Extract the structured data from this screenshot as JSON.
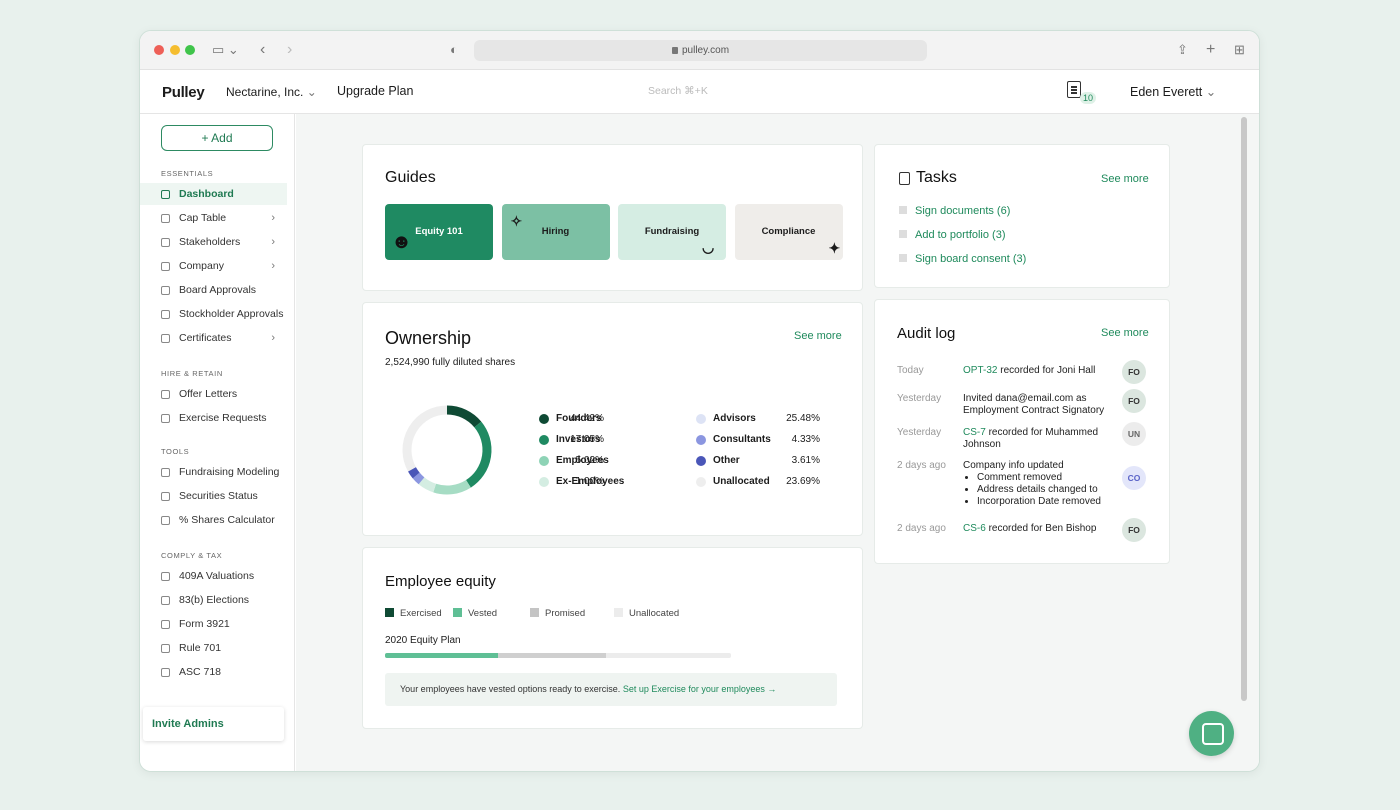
{
  "browser": {
    "url": "pulley.com"
  },
  "topbar": {
    "logo": "Pulley",
    "company": "Nectarine, Inc.",
    "upgrade": "Upgrade Plan",
    "search_placeholder": "Search ⌘+K",
    "task_count": "10",
    "user": "Eden Everett"
  },
  "sidebar": {
    "add_label": "+ Add",
    "sections": [
      {
        "title": "ESSENTIALS",
        "items": [
          {
            "label": "Dashboard",
            "active": true,
            "chevron": false,
            "icon": "home-icon"
          },
          {
            "label": "Cap Table",
            "chevron": true,
            "icon": "table-icon"
          },
          {
            "label": "Stakeholders",
            "chevron": true,
            "icon": "people-icon"
          },
          {
            "label": "Company",
            "chevron": true,
            "icon": "building-icon"
          },
          {
            "label": "Board Approvals",
            "chevron": false,
            "icon": "thumbs-up-icon"
          },
          {
            "label": "Stockholder Approvals",
            "chevron": false,
            "icon": "thumbs-up-icon"
          },
          {
            "label": "Certificates",
            "chevron": true,
            "icon": "certificate-icon"
          }
        ]
      },
      {
        "title": "HIRE & RETAIN",
        "items": [
          {
            "label": "Offer Letters",
            "icon": "heart-icon"
          },
          {
            "label": "Exercise Requests",
            "icon": "coin-icon"
          }
        ]
      },
      {
        "title": "TOOLS",
        "items": [
          {
            "label": "Fundraising Modeling",
            "icon": "sparkle-icon"
          },
          {
            "label": "Securities Status",
            "icon": "document-icon"
          },
          {
            "label": "% Shares Calculator",
            "icon": "calculator-icon"
          }
        ]
      },
      {
        "title": "COMPLY & TAX",
        "items": [
          {
            "label": "409A Valuations",
            "icon": "shield-check-icon"
          },
          {
            "label": "83(b) Elections",
            "icon": "shield-check-icon"
          },
          {
            "label": "Form 3921",
            "icon": "document-icon"
          },
          {
            "label": "Rule 701",
            "icon": "document-icon"
          },
          {
            "label": "ASC 718",
            "icon": "document-icon"
          }
        ]
      }
    ],
    "invite": "Invite Admins"
  },
  "guides": {
    "title": "Guides",
    "items": [
      {
        "label": "Equity 101",
        "bg": "#1f8a62",
        "color": "#ffffff"
      },
      {
        "label": "Hiring",
        "bg": "#7cc0a4",
        "color": "#1c1c1c"
      },
      {
        "label": "Fundraising",
        "bg": "#d5ede3",
        "color": "#1c1c1c"
      },
      {
        "label": "Compliance",
        "bg": "#efedea",
        "color": "#1c1c1c"
      }
    ]
  },
  "ownership": {
    "title": "Ownership",
    "see_more": "See more",
    "shares": "2,524,990",
    "shares_suffix": " fully diluted shares",
    "legend_left": [
      {
        "name": "Founders",
        "value": "44.42%",
        "color": "#0f4a34"
      },
      {
        "name": "Investors",
        "value": "17.05%",
        "color": "#1f8a62"
      },
      {
        "name": "Employees",
        "value": "5.02%",
        "color": "#8ed3b6"
      },
      {
        "name": "Ex-Employees",
        "value": "1.00%",
        "color": "#d4ede2"
      }
    ],
    "legend_right": [
      {
        "name": "Advisors",
        "value": "25.48%",
        "color": "#dde3f5"
      },
      {
        "name": "Consultants",
        "value": "4.33%",
        "color": "#8b96e0"
      },
      {
        "name": "Other",
        "value": "3.61%",
        "color": "#4a56b8"
      },
      {
        "name": "Unallocated",
        "value": "23.69%",
        "color": "#eeeeee"
      }
    ]
  },
  "chart_data": {
    "type": "pie",
    "segments": [
      {
        "name": "Founders",
        "value": 14,
        "color": "#0f4a34"
      },
      {
        "name": "Investors",
        "value": 27,
        "color": "#1f8a62"
      },
      {
        "name": "Employees",
        "value": 14,
        "color": "#a6dcc4"
      },
      {
        "name": "Ex-Employees",
        "value": 6,
        "color": "#d4ede2"
      },
      {
        "name": "Consultants",
        "value": 3,
        "color": "#8b96e0"
      },
      {
        "name": "Other",
        "value": 3,
        "color": "#4a56b8"
      },
      {
        "name": "Unallocated",
        "value": 33,
        "color": "#eeeeee"
      }
    ]
  },
  "employee_equity": {
    "title": "Employee equity",
    "legend": [
      {
        "label": "Exercised",
        "color": "#0f4a34"
      },
      {
        "label": "Vested",
        "color": "#5fbf95"
      },
      {
        "label": "Promised",
        "color": "#c4c4c4"
      },
      {
        "label": "Unallocated",
        "color": "#ececec"
      }
    ],
    "plan": "2020 Equity Plan",
    "bar": [
      {
        "name": "Vested",
        "fraction": 0.326,
        "color": "#5fbf95"
      },
      {
        "name": "Promised",
        "fraction": 0.312,
        "color": "#cfcfcf"
      },
      {
        "name": "Unallocated",
        "fraction": 0.362,
        "color": "#ececec"
      }
    ],
    "notice": "Your employees have vested options ready to exercise. ",
    "notice_link": "Set up Exercise for your employees →"
  },
  "tasks": {
    "title": "Tasks",
    "see_more": "See more",
    "items": [
      "Sign documents (6)",
      "Add to portfolio (3)",
      "Sign board consent (3)"
    ]
  },
  "audit": {
    "title": "Audit log",
    "see_more": "See more",
    "rows": [
      {
        "when": "Today",
        "link": "OPT-32",
        "text": " recorded for Joni Hall",
        "avatar": "FO",
        "av_bg": "#dbe6df",
        "av_color": "#333"
      },
      {
        "when": "Yesterday",
        "link": "",
        "text": "Invited dana@email.com as Employment Contract Signatory",
        "avatar": "FO",
        "av_bg": "#dbe6df",
        "av_color": "#333"
      },
      {
        "when": "Yesterday",
        "link": "CS-7",
        "text": " recorded for Muhammed Johnson",
        "avatar": "UN",
        "av_bg": "#ececec",
        "av_color": "#666"
      },
      {
        "when": "2 days ago",
        "link": "",
        "text": "Company info updated",
        "bullets": [
          "Comment removed",
          "Address details changed to",
          "Incorporation Date removed"
        ],
        "avatar": "CO",
        "av_bg": "#e3e6fa",
        "av_color": "#5a63c8"
      },
      {
        "when": "2 days ago",
        "link": "CS-6",
        "text": " recorded for Ben Bishop",
        "avatar": "FO",
        "av_bg": "#dbe6df",
        "av_color": "#333"
      }
    ]
  }
}
